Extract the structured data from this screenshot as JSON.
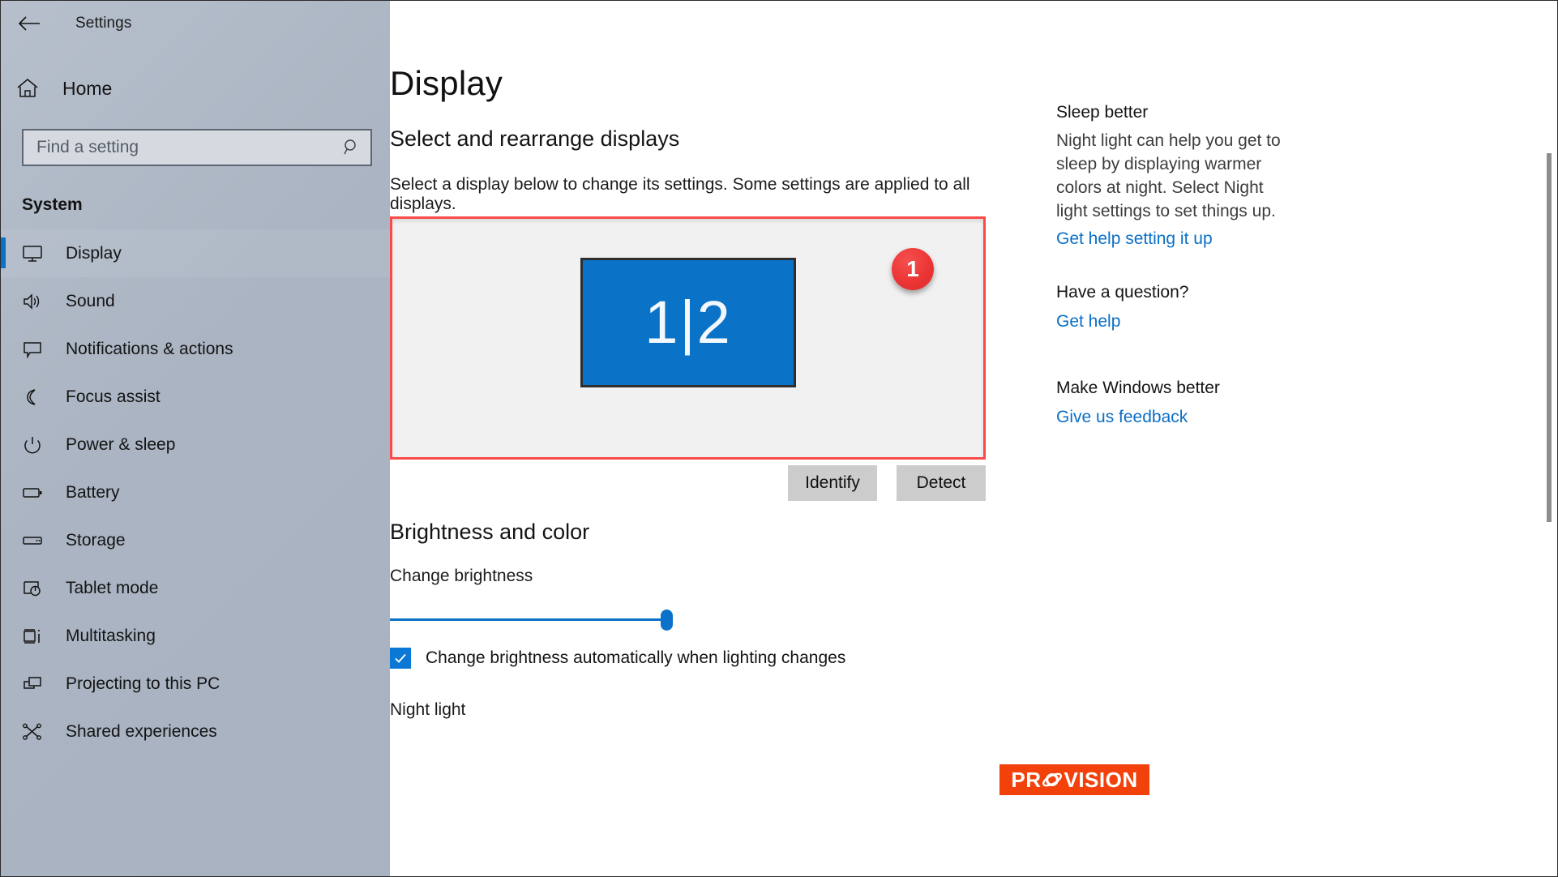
{
  "window": {
    "title": "Settings",
    "back_icon": "back-arrow-icon",
    "controls": {
      "minimize": "minimize-icon",
      "restore": "restore-icon",
      "close": "close-icon"
    }
  },
  "sidebar": {
    "home": {
      "label": "Home",
      "icon": "home-icon"
    },
    "search": {
      "placeholder": "Find a setting",
      "value": "",
      "icon": "search-icon"
    },
    "group_label": "System",
    "items": [
      {
        "label": "Display",
        "icon": "monitor-icon",
        "selected": true
      },
      {
        "label": "Sound",
        "icon": "speaker-icon",
        "selected": false
      },
      {
        "label": "Notifications & actions",
        "icon": "notification-icon",
        "selected": false
      },
      {
        "label": "Focus assist",
        "icon": "moon-icon",
        "selected": false
      },
      {
        "label": "Power & sleep",
        "icon": "power-icon",
        "selected": false
      },
      {
        "label": "Battery",
        "icon": "battery-icon",
        "selected": false
      },
      {
        "label": "Storage",
        "icon": "storage-icon",
        "selected": false
      },
      {
        "label": "Tablet mode",
        "icon": "tablet-icon",
        "selected": false
      },
      {
        "label": "Multitasking",
        "icon": "multitasking-icon",
        "selected": false
      },
      {
        "label": "Projecting to this PC",
        "icon": "projecting-icon",
        "selected": false
      },
      {
        "label": "Shared experiences",
        "icon": "shared-icon",
        "selected": false
      }
    ]
  },
  "main": {
    "page_title": "Display",
    "section_displays": {
      "heading": "Select and rearrange displays",
      "description": "Select a display below to change its settings. Some settings are applied to all displays.",
      "monitor_label": "1|2",
      "step_badge": "1",
      "identify_button": "Identify",
      "detect_button": "Detect"
    },
    "section_brightness": {
      "heading": "Brightness and color",
      "brightness_label": "Change brightness",
      "brightness_value": 97,
      "auto_brightness_label": "Change brightness automatically when lighting changes",
      "auto_brightness_checked": true,
      "check_icon": "checkmark-icon",
      "night_light_label": "Night light"
    }
  },
  "rail": [
    {
      "heading": "Sleep better",
      "body": "Night light can help you get to sleep by displaying warmer colors at night. Select Night light settings to set things up.",
      "link": "Get help setting it up"
    },
    {
      "heading": "Have a question?",
      "body": "",
      "link": "Get help"
    },
    {
      "heading": "Make Windows better",
      "body": "",
      "link": "Give us feedback"
    }
  ],
  "logo": {
    "part1": "PR",
    "part2": "VISION",
    "swirl_icon": "atom-swirl-icon"
  },
  "colors": {
    "accent_blue": "#0a72c8",
    "selection_red": "#fb4a4a",
    "badge_red": "#ec3535",
    "logo_orange": "#f2410a",
    "sidebar_gray": "#aab4c2"
  }
}
